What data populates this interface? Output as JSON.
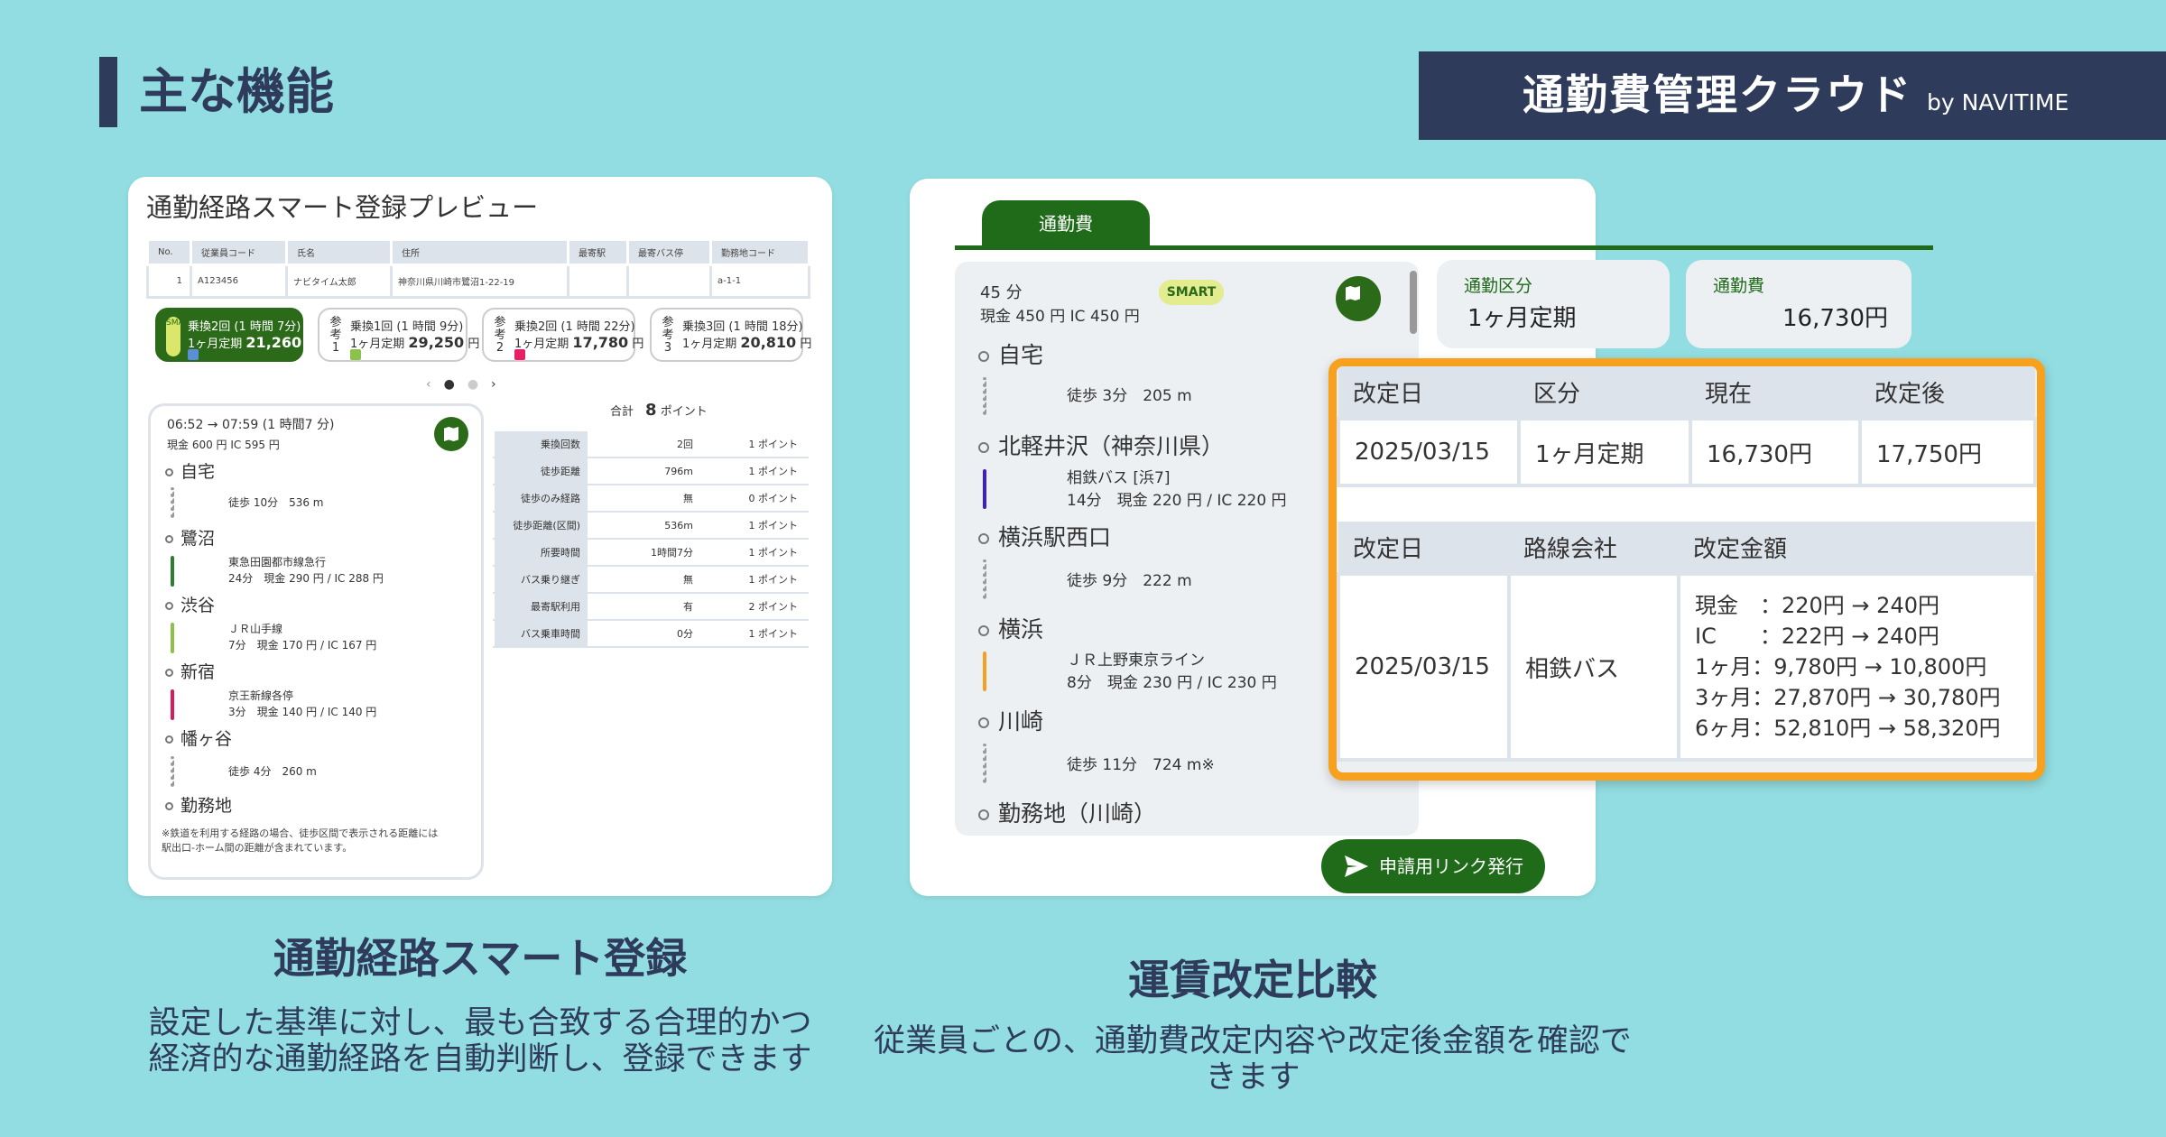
{
  "heading": "主な機能",
  "brand": {
    "name": "通勤費管理クラウド",
    "by": "by NAVITIME"
  },
  "left_card": {
    "title": "通勤経路スマート登録プレビュー",
    "employee_table": {
      "headers": [
        "No.",
        "従業員コード",
        "氏名",
        "住所",
        "最寄駅",
        "最寄バス停",
        "勤務地コード"
      ],
      "row": [
        "1",
        "A123456",
        "ナビタイム太郎",
        "神奈川県川崎市鷺沼1-22-19",
        "",
        "",
        "a-1-1"
      ]
    },
    "options": [
      {
        "tag": "SMART",
        "line1": "乗換2回 (1 時間 7分)",
        "line2_prefix": "1ヶ月定期",
        "line2_amount": "21,260",
        "line2_unit": "円",
        "badge_color": "#5B8FD6"
      },
      {
        "tag": "参考1",
        "line1": "乗換1回 (1 時間 9分)",
        "line2_prefix": "1ヶ月定期",
        "line2_amount": "29,250",
        "line2_unit": "円",
        "badge_color": "#8BC34A"
      },
      {
        "tag": "参考2",
        "line1": "乗換2回 (1 時間 22分)",
        "line2_prefix": "1ヶ月定期",
        "line2_amount": "17,780",
        "line2_unit": "円",
        "badge_color": "#E91E63"
      },
      {
        "tag": "参考3",
        "line1": "乗換3回 (1 時間 18分)",
        "line2_prefix": "1ヶ月定期",
        "line2_amount": "20,810",
        "line2_unit": "円",
        "badge_color": ""
      }
    ],
    "pager": {
      "prev": "‹",
      "next": "›",
      "current": 1,
      "total": 3
    },
    "route": {
      "time": "06:52 → 07:59 (1 時間7 分)",
      "fare": "現金 600 円 IC 595 円",
      "stations": [
        "自宅",
        "鷺沼",
        "渋谷",
        "新宿",
        "幡ヶ谷",
        "勤務地"
      ],
      "segments": [
        {
          "type": "walk",
          "text": "徒歩 10分　536 m",
          "color": "#999999"
        },
        {
          "type": "rail",
          "line": "東急田園都市線急行",
          "text": "24分　現金 290 円 / IC 288 円",
          "color": "#2E7D32"
        },
        {
          "type": "rail",
          "line": "ＪＲ山手線",
          "text": "7分　現金 170 円 / IC 167 円",
          "color": "#8BC34A"
        },
        {
          "type": "rail",
          "line": "京王新線各停",
          "text": "3分　現金 140 円 / IC 140 円",
          "color": "#D81B60"
        },
        {
          "type": "walk",
          "text": "徒歩 4分　260 m",
          "color": "#999999"
        }
      ],
      "note": "※鉄道を利用する経路の場合、徒歩区間で表示される距離には駅出口-ホーム間の距離が含まれています。"
    },
    "points": {
      "total_label": "合計",
      "total_value": "8",
      "total_unit": "ポイント",
      "rows": [
        {
          "k": "乗換回数",
          "v": "2回",
          "p": "1 ポイント"
        },
        {
          "k": "徒歩距離",
          "v": "796m",
          "p": "1 ポイント"
        },
        {
          "k": "徒歩のみ経路",
          "v": "無",
          "p": "0 ポイント"
        },
        {
          "k": "徒歩距離(区間)",
          "v": "536m",
          "p": "1 ポイント"
        },
        {
          "k": "所要時間",
          "v": "1時間7分",
          "p": "1 ポイント"
        },
        {
          "k": "バス乗り継ぎ",
          "v": "無",
          "p": "1 ポイント"
        },
        {
          "k": "最寄駅利用",
          "v": "有",
          "p": "2 ポイント"
        },
        {
          "k": "バス乗車時間",
          "v": "0分",
          "p": "1 ポイント"
        }
      ]
    }
  },
  "right_card": {
    "tab": "通勤費",
    "route": {
      "duration": "45 分",
      "fare": "現金 450 円 IC 450 円",
      "smart": "SMART",
      "stations": [
        "自宅",
        "北軽井沢（神奈川県）",
        "横浜駅西口",
        "横浜",
        "川崎",
        "勤務地（川崎）"
      ],
      "segments": [
        {
          "type": "walk",
          "text": "徒歩 3分　205 m",
          "color": "#999999"
        },
        {
          "type": "bus",
          "line": "相鉄バス [浜7]",
          "text": "14分　現金 220 円 / IC 220 円",
          "color": "#3F1DCB"
        },
        {
          "type": "walk",
          "text": "徒歩 9分　222 m",
          "color": "#999999"
        },
        {
          "type": "rail",
          "line": "ＪＲ上野東京ライン",
          "text": "8分　現金 230 円 / IC 230 円",
          "color": "#F5A020"
        },
        {
          "type": "walk",
          "text": "徒歩 11分　724 m※",
          "color": "#999999"
        }
      ]
    },
    "commute_type": {
      "label": "通勤区分",
      "value": "1ヶ月定期"
    },
    "commute_fee": {
      "label": "通勤費",
      "value": "16,730円"
    },
    "revision_table1": {
      "headers": [
        "改定日",
        "区分",
        "現在",
        "改定後"
      ],
      "row": [
        "2025/03/15",
        "1ヶ月定期",
        "16,730円",
        "17,750円"
      ]
    },
    "revision_table2": {
      "headers": [
        "改定日",
        "路線会社",
        "改定金額"
      ],
      "row": [
        "2025/03/15",
        "相鉄バス"
      ],
      "amounts": [
        "現金　：220円 → 240円",
        "IC　　：222円 → 240円",
        "1ヶ月：9,780円 → 10,800円",
        "3ヶ月：27,870円 → 30,780円",
        "6ヶ月：52,810円 → 58,320円"
      ]
    },
    "apply_button": "申請用リンク発行"
  },
  "captions": {
    "left_title": "通勤経路スマート登録",
    "left_desc": [
      "設定した基準に対し、最も合致する合理的かつ",
      "経済的な通勤経路を自動判断し、登録できます"
    ],
    "right_title": "運賃改定比較",
    "right_desc": "従業員ごとの、通勤費改定内容や改定後金額を確認できます"
  },
  "colors": {
    "background": "#92DDE1",
    "navy": "#2E3B5B",
    "green": "#1F6B1A",
    "orange": "#F7A11E"
  }
}
